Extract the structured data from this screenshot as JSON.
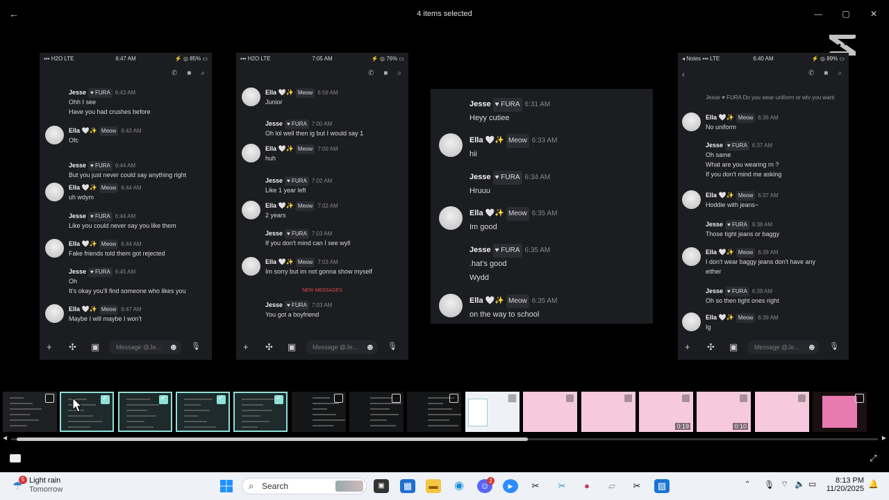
{
  "window": {
    "title": "4 items selected",
    "back": "←",
    "minimize": "—",
    "maximize": "▢",
    "close": "✕"
  },
  "panels": [
    {
      "status": {
        "left": "▪▪▪ H2O LTE",
        "center": "6:47 AM",
        "right": "⚡ ◎ 85% ▭"
      },
      "composer_placeholder": "Message @Je...",
      "messages": [
        {
          "name": "Jesse",
          "tag": "♥ FURA",
          "time": "6:43 AM",
          "lines": [
            "Ohh I see",
            "Have you had crushes before"
          ],
          "avatar": false
        },
        {
          "name": "Ella 🤍✨",
          "tag": "Meow",
          "time": "6:43 AM",
          "lines": [
            "Ofc"
          ],
          "avatar": true
        },
        {
          "name": "Jesse",
          "tag": "♥ FURA",
          "time": "6:44 AM",
          "lines": [
            "But you just never could say anything right"
          ],
          "avatar": false
        },
        {
          "name": "Ella 🤍✨",
          "tag": "Meow",
          "time": "6:44 AM",
          "lines": [
            "uh wdym"
          ],
          "avatar": true
        },
        {
          "name": "Jesse",
          "tag": "♥ FURA",
          "time": "6:44 AM",
          "lines": [
            "Like you could never say you like them"
          ],
          "avatar": false
        },
        {
          "name": "Ella 🤍✨",
          "tag": "Meow",
          "time": "6:44 AM",
          "lines": [
            "Fake friends told them got rejected"
          ],
          "avatar": true
        },
        {
          "name": "Jesse",
          "tag": "♥ FURA",
          "time": "6:45 AM",
          "lines": [
            "Oh",
            "It's okay you'll find someone who likes you"
          ],
          "avatar": false
        },
        {
          "name": "Ella 🤍✨",
          "tag": "Meow",
          "time": "6:47 AM",
          "lines": [
            "Maybe I will maybe I won't"
          ],
          "avatar": true
        }
      ]
    },
    {
      "status": {
        "left": "▪▪▪ H2O LTE",
        "center": "7:05 AM",
        "right": "⚡ ◎ 76% ▭"
      },
      "composer_placeholder": "Message @Je...",
      "new_messages": "NEW MESSAGES",
      "messages": [
        {
          "name": "Ella 🤍✨",
          "tag": "Meow",
          "time": "6:59 AM",
          "lines": [
            "Junior"
          ],
          "avatar": true
        },
        {
          "name": "Jesse",
          "tag": "♥ FURA",
          "time": "7:00 AM",
          "lines": [
            "Oh lol well then ig but I would say 1"
          ],
          "avatar": false
        },
        {
          "name": "Ella 🤍✨",
          "tag": "Meow",
          "time": "7:00 AM",
          "lines": [
            "huh"
          ],
          "avatar": true
        },
        {
          "name": "Jesse",
          "tag": "♥ FURA",
          "time": "7:02 AM",
          "lines": [
            "Like 1 year left"
          ],
          "avatar": false
        },
        {
          "name": "Ella 🤍✨",
          "tag": "Meow",
          "time": "7:02 AM",
          "lines": [
            "2 years"
          ],
          "avatar": true
        },
        {
          "name": "Jesse",
          "tag": "♥ FURA",
          "time": "7:03 AM",
          "lines": [
            "If you don't mind can I see wyll"
          ],
          "avatar": false
        },
        {
          "name": "Ella 🤍✨",
          "tag": "Meow",
          "time": "7:03 AM",
          "lines": [
            "Im sorry but im not gonna show myself"
          ],
          "avatar": true
        },
        {
          "name": "Jesse",
          "tag": "♥ FURA",
          "time": "7:03 AM",
          "lines": [
            "You got a boyfriend"
          ],
          "avatar": false
        }
      ]
    },
    {
      "messages": [
        {
          "name": "Jesse",
          "tag": "♥ FURA",
          "time": "6:31 AM",
          "lines": [
            "Heyy cutiee"
          ],
          "avatar": false
        },
        {
          "name": "Ella 🤍✨",
          "tag": "Meow",
          "time": "6:33 AM",
          "lines": [
            "hii"
          ],
          "avatar": true
        },
        {
          "name": "Jesse",
          "tag": "♥ FURA",
          "time": "6:34 AM",
          "lines": [
            "Hruuu"
          ],
          "avatar": false
        },
        {
          "name": "Ella 🤍✨",
          "tag": "Meow",
          "time": "6:35 AM",
          "lines": [
            "Im good"
          ],
          "avatar": true
        },
        {
          "name": "Jesse",
          "tag": "♥ FURA",
          "time": "6:35 AM",
          "lines": [
            ".hat's good",
            "Wydd"
          ],
          "avatar": false
        },
        {
          "name": "Ella 🤍✨",
          "tag": "Meow",
          "time": "6:35 AM",
          "lines": [
            "on the way to school"
          ],
          "avatar": true
        }
      ]
    },
    {
      "status": {
        "left": "◂ Notes ▪▪▪ LTE",
        "center": "6:40 AM",
        "right": "⚡ ◎ 89% ▭"
      },
      "composer_placeholder": "Message @Je...",
      "reply": "Jesse ♥ FURA Do you wear uniform or wtv you want",
      "messages": [
        {
          "name": "Ella 🤍✨",
          "tag": "Meow",
          "time": "6:36 AM",
          "lines": [
            "No uniform"
          ],
          "avatar": true
        },
        {
          "name": "Jesse",
          "tag": "♥ FURA",
          "time": "6:37 AM",
          "lines": [
            "Oh same",
            "What are you wearing rn ?",
            "If you don't mind me asking"
          ],
          "avatar": false
        },
        {
          "name": "Ella 🤍✨",
          "tag": "Meow",
          "time": "6:37 AM",
          "lines": [
            "Hoddie with jeans~"
          ],
          "avatar": true
        },
        {
          "name": "Jesse",
          "tag": "♥ FURA",
          "time": "6:38 AM",
          "lines": [
            "Those tight jeans or baggy"
          ],
          "avatar": false
        },
        {
          "name": "Ella 🤍✨",
          "tag": "Meow",
          "time": "6:39 AM",
          "lines": [
            "I don't wear baggy jeans don't have any",
            "either"
          ],
          "avatar": true
        },
        {
          "name": "Jesse",
          "tag": "♥ FURA",
          "time": "6:39 AM",
          "lines": [
            "Oh so then tight ones right"
          ],
          "avatar": false
        },
        {
          "name": "Ella 🤍✨",
          "tag": "Meow",
          "time": "6:39 AM",
          "lines": [
            "Ig"
          ],
          "avatar": true
        }
      ]
    }
  ],
  "filmstrip": [
    {
      "selected": false,
      "kind": "chat"
    },
    {
      "selected": true,
      "kind": "chat"
    },
    {
      "selected": true,
      "kind": "chat"
    },
    {
      "selected": true,
      "kind": "chat"
    },
    {
      "selected": true,
      "kind": "chat"
    },
    {
      "selected": false,
      "kind": "dark"
    },
    {
      "selected": false,
      "kind": "dark"
    },
    {
      "selected": false,
      "kind": "dark"
    },
    {
      "selected": false,
      "kind": "light"
    },
    {
      "selected": false,
      "kind": "pink"
    },
    {
      "selected": false,
      "kind": "pink"
    },
    {
      "selected": false,
      "kind": "pink",
      "duration": "0:19"
    },
    {
      "selected": false,
      "kind": "pink",
      "duration": "0:10"
    },
    {
      "selected": false,
      "kind": "pink"
    },
    {
      "selected": false,
      "kind": "pinkdark"
    }
  ],
  "taskbar": {
    "weather_badge": "5",
    "weather_title": "Light rain",
    "weather_sub": "Tomorrow",
    "search_placeholder": "Search",
    "discord_badge": "2",
    "time": "8:13 PM",
    "date": "11/20/2025"
  },
  "colors": {
    "accent": "#8fe0d8",
    "panel": "#1c1d21",
    "fura": "#e85d8a"
  }
}
